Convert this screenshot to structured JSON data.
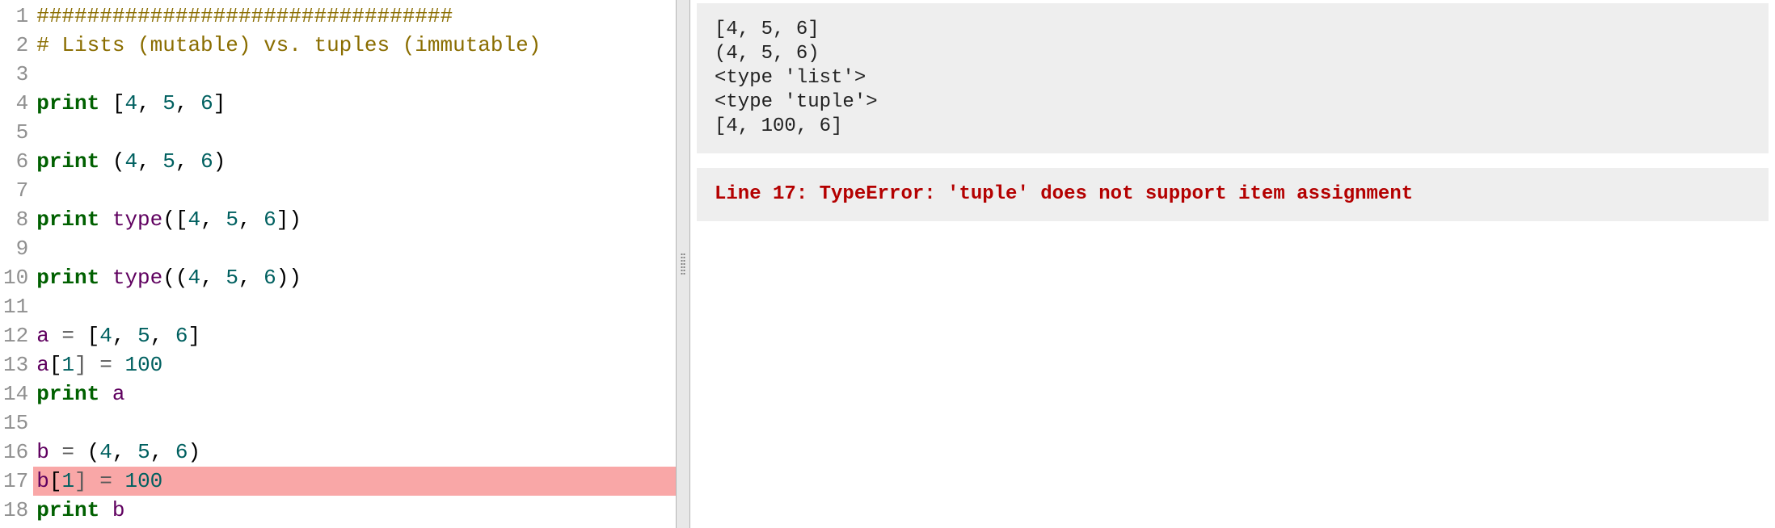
{
  "editor": {
    "highlight_line": 17,
    "lines": [
      {
        "n": 1,
        "tokens": [
          {
            "t": "#################################",
            "c": "c-cmt"
          }
        ]
      },
      {
        "n": 2,
        "tokens": [
          {
            "t": "# Lists (mutable) vs. tuples (immutable)",
            "c": "c-cmt"
          }
        ]
      },
      {
        "n": 3,
        "tokens": []
      },
      {
        "n": 4,
        "tokens": [
          {
            "t": "print",
            "c": "c-kw"
          },
          {
            "t": " ["
          },
          {
            "t": "4",
            "c": "c-num"
          },
          {
            "t": ", "
          },
          {
            "t": "5",
            "c": "c-num"
          },
          {
            "t": ", "
          },
          {
            "t": "6",
            "c": "c-num"
          },
          {
            "t": "]"
          }
        ]
      },
      {
        "n": 5,
        "tokens": []
      },
      {
        "n": 6,
        "tokens": [
          {
            "t": "print",
            "c": "c-kw"
          },
          {
            "t": " ("
          },
          {
            "t": "4",
            "c": "c-num"
          },
          {
            "t": ", "
          },
          {
            "t": "5",
            "c": "c-num"
          },
          {
            "t": ", "
          },
          {
            "t": "6",
            "c": "c-num"
          },
          {
            "t": ")"
          }
        ]
      },
      {
        "n": 7,
        "tokens": []
      },
      {
        "n": 8,
        "tokens": [
          {
            "t": "print",
            "c": "c-kw"
          },
          {
            "t": " "
          },
          {
            "t": "type",
            "c": "c-bi"
          },
          {
            "t": "(["
          },
          {
            "t": "4",
            "c": "c-num"
          },
          {
            "t": ", "
          },
          {
            "t": "5",
            "c": "c-num"
          },
          {
            "t": ", "
          },
          {
            "t": "6",
            "c": "c-num"
          },
          {
            "t": "])"
          }
        ]
      },
      {
        "n": 9,
        "tokens": []
      },
      {
        "n": 10,
        "tokens": [
          {
            "t": "print",
            "c": "c-kw"
          },
          {
            "t": " "
          },
          {
            "t": "type",
            "c": "c-bi"
          },
          {
            "t": "(("
          },
          {
            "t": "4",
            "c": "c-num"
          },
          {
            "t": ", "
          },
          {
            "t": "5",
            "c": "c-num"
          },
          {
            "t": ", "
          },
          {
            "t": "6",
            "c": "c-num"
          },
          {
            "t": "))"
          }
        ]
      },
      {
        "n": 11,
        "tokens": []
      },
      {
        "n": 12,
        "tokens": [
          {
            "t": "a",
            "c": "c-bi"
          },
          {
            "t": " = ",
            "c": "c-op"
          },
          {
            "t": "["
          },
          {
            "t": "4",
            "c": "c-num"
          },
          {
            "t": ", "
          },
          {
            "t": "5",
            "c": "c-num"
          },
          {
            "t": ", "
          },
          {
            "t": "6",
            "c": "c-num"
          },
          {
            "t": "]"
          }
        ]
      },
      {
        "n": 13,
        "tokens": [
          {
            "t": "a",
            "c": "c-bi"
          },
          {
            "t": "["
          },
          {
            "t": "1",
            "c": "c-num"
          },
          {
            "t": "] = ",
            "c": "c-op"
          },
          {
            "t": "100",
            "c": "c-num"
          }
        ]
      },
      {
        "n": 14,
        "tokens": [
          {
            "t": "print",
            "c": "c-kw"
          },
          {
            "t": " "
          },
          {
            "t": "a",
            "c": "c-bi"
          }
        ]
      },
      {
        "n": 15,
        "tokens": []
      },
      {
        "n": 16,
        "tokens": [
          {
            "t": "b",
            "c": "c-bi"
          },
          {
            "t": " = ",
            "c": "c-op"
          },
          {
            "t": "("
          },
          {
            "t": "4",
            "c": "c-num"
          },
          {
            "t": ", "
          },
          {
            "t": "5",
            "c": "c-num"
          },
          {
            "t": ", "
          },
          {
            "t": "6",
            "c": "c-num"
          },
          {
            "t": ")"
          }
        ]
      },
      {
        "n": 17,
        "tokens": [
          {
            "t": "b",
            "c": "c-bi"
          },
          {
            "t": "["
          },
          {
            "t": "1",
            "c": "c-num"
          },
          {
            "t": "] = ",
            "c": "c-op"
          },
          {
            "t": "100",
            "c": "c-num"
          }
        ]
      },
      {
        "n": 18,
        "tokens": [
          {
            "t": "print",
            "c": "c-kw"
          },
          {
            "t": " "
          },
          {
            "t": "b",
            "c": "c-bi"
          }
        ]
      }
    ]
  },
  "output": {
    "stdout": "[4, 5, 6]\n(4, 5, 6)\n<type 'list'>\n<type 'tuple'>\n[4, 100, 6]",
    "stderr": "Line 17: TypeError: 'tuple' does not support item assignment"
  }
}
